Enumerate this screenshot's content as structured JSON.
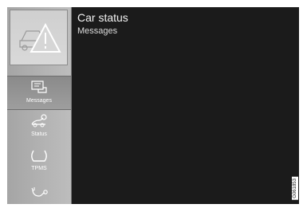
{
  "header": {
    "title": "Car status",
    "subtitle": "Messages"
  },
  "sidebar": {
    "top_icon": "car-warning-icon",
    "items": [
      {
        "label": "Messages",
        "icon": "messages-icon",
        "active": true
      },
      {
        "label": "Status",
        "icon": "car-status-icon",
        "active": false
      },
      {
        "label": "TPMS",
        "icon": "tpms-icon",
        "active": false
      },
      {
        "label": "",
        "icon": "service-icon",
        "active": false
      }
    ]
  },
  "image_code": "G061853",
  "colors": {
    "sidebar": "#b3b3b3",
    "active_item": "#949494",
    "content_bg": "#1b1b1b",
    "text": "#f2f2f2"
  }
}
